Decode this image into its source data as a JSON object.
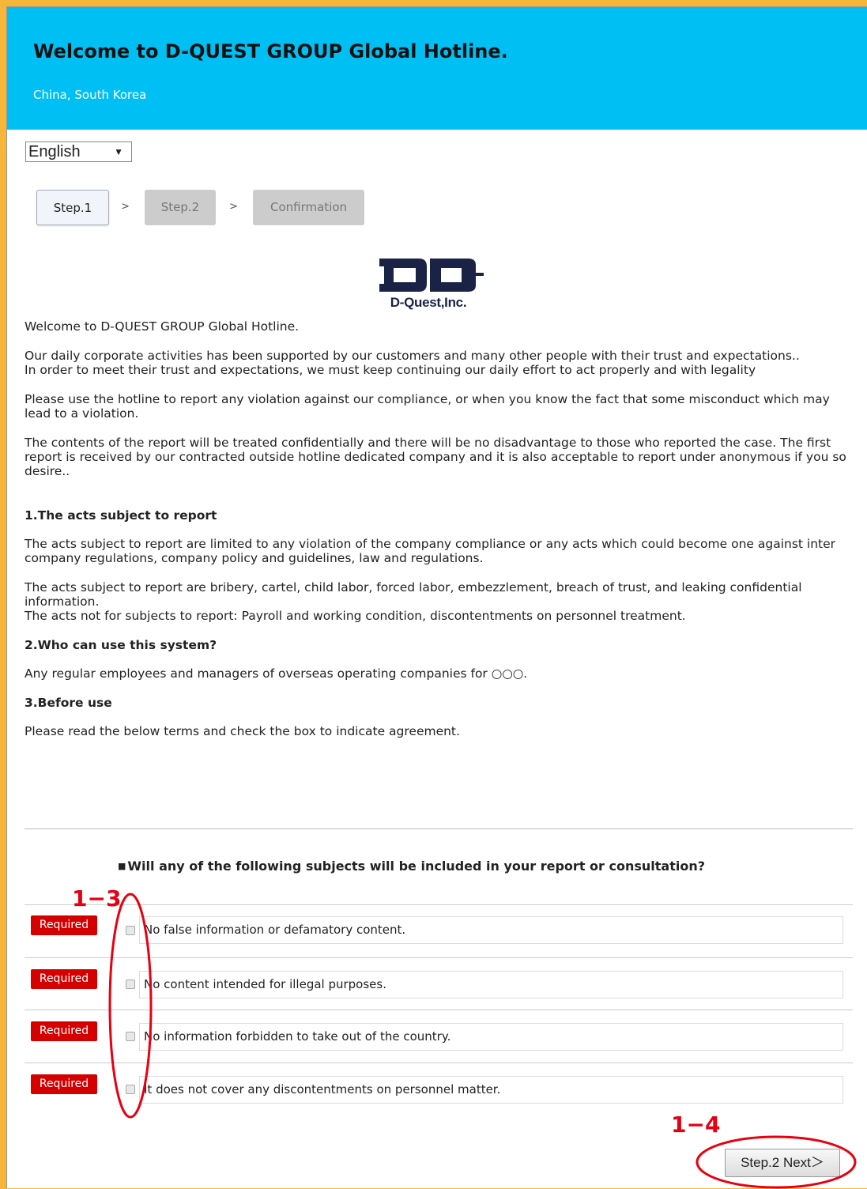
{
  "header": {
    "title": "Welcome to D-QUEST GROUP Global Hotline.",
    "subtitle": "China, South Korea"
  },
  "language": {
    "selected": "English",
    "arrow": "▼"
  },
  "steps": {
    "step1": "Step.1",
    "step2": "Step.2",
    "confirmation": "Confirmation",
    "separator": ">"
  },
  "logo": {
    "text": "D-Quest,Inc."
  },
  "intro": {
    "welcome": "Welcome to D-QUEST GROUP Global Hotline.",
    "p1a": "Our daily corporate activities has been supported by our customers and many other people with their trust and expectations..",
    "p1b": "In order to meet their trust and expectations, we must keep continuing our daily effort to act properly and with legality",
    "p2": "Please use the hotline to report any violation against our compliance, or when you know the fact that some misconduct which may lead to a violation.",
    "p3": "The contents of the report will be treated confidentially and there will be no disadvantage to those who reported the case. The first report is received by our contracted outside hotline dedicated company and it is also acceptable to report under anonymous if you so desire.."
  },
  "section1": {
    "heading": "1.The acts subject to report",
    "p1": "The acts subject to report are limited to any violation of the company compliance or any acts which could become one against inter company regulations, company policy and guidelines, law and regulations.",
    "p2a": "The acts subject to report are bribery, cartel, child labor, forced labor, embezzlement, breach of trust, and leaking confidential information.",
    "p2b": "The acts not for subjects to report: Payroll and working condition, discontentments on personnel treatment."
  },
  "section2": {
    "heading": "2.Who can use this system?",
    "p1": "Any regular employees and managers of overseas operating companies for ○○○."
  },
  "section3": {
    "heading": "3.Before use",
    "p1": "Please read the below terms and check the box to indicate agreement."
  },
  "question": {
    "marker": "■",
    "text": "Will any of the following subjects will be included in your report or consultation?"
  },
  "agreements": [
    {
      "badge": "Required",
      "text": "No false information or defamatory content."
    },
    {
      "badge": "Required",
      "text": "No content intended for illegal purposes."
    },
    {
      "badge": "Required",
      "text": "No information forbidden to take out of the country."
    },
    {
      "badge": "Required",
      "text": "It does not cover any discontentments on personnel matter."
    }
  ],
  "annotations": {
    "a13": "1−3",
    "a14": "1−4",
    "color": "#e60012"
  },
  "next_button": "Step.2 Next＞",
  "colors": {
    "header": "#00bff3",
    "required": "#d40000",
    "page_bg": "#f5b63a"
  }
}
